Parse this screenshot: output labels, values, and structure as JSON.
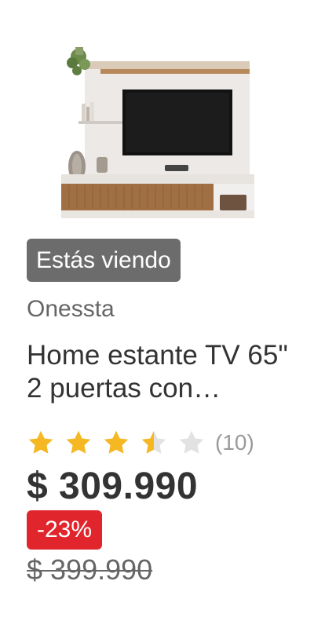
{
  "product": {
    "image_icon": "tv-stand-image",
    "badge": "Estás viendo",
    "brand": "Onessta",
    "title": "Home estante TV 65\" 2 puertas con…",
    "rating": {
      "stars": 3.5,
      "max": 5,
      "count_text": "(10)"
    },
    "price": "$ 309.990",
    "discount": "-23%",
    "old_price": "$ 399.990"
  },
  "colors": {
    "badge_bg": "#6c6c6c",
    "discount_bg": "#e0262c",
    "star_filled": "#f5b823",
    "star_empty": "#e2e2e2",
    "text_dark": "#333333",
    "text_muted": "#666666"
  }
}
